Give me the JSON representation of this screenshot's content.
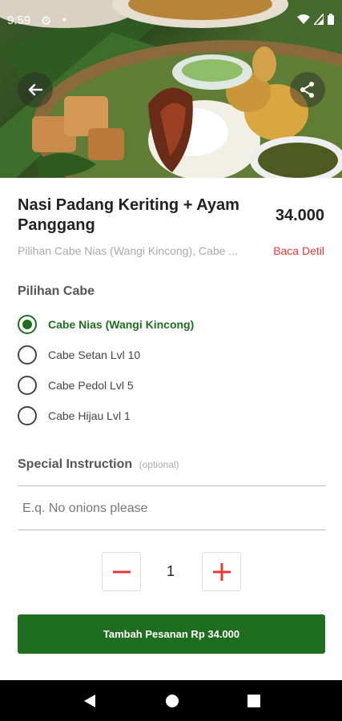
{
  "status_bar": {
    "time": "9:59",
    "icons": [
      "gear-icon",
      "dot-icon",
      "wifi-icon",
      "signal-icon",
      "battery-icon"
    ]
  },
  "hero": {
    "icons": {
      "back": "arrow-left-icon",
      "share": "share-icon"
    }
  },
  "product": {
    "title": "Nasi Padang Keriting + Ayam Panggang",
    "price": "34.000",
    "subtitle": "Pilihan Cabe Nias (Wangi Kincong), Cabe ...",
    "detail_link": "Baca Detil"
  },
  "options": {
    "title": "Pilihan Cabe",
    "items": [
      {
        "label": "Cabe Nias (Wangi Kincong)",
        "selected": true
      },
      {
        "label": "Cabe Setan Lvl 10",
        "selected": false
      },
      {
        "label": "Cabe Pedol Lvl 5",
        "selected": false
      },
      {
        "label": "Cabe Hijau Lvl 1",
        "selected": false
      }
    ]
  },
  "special": {
    "title": "Special Instruction",
    "optional_label": "(optional)",
    "placeholder": "E.q. No onions please",
    "value": ""
  },
  "quantity": {
    "value": "1"
  },
  "cta": {
    "label": "Tambah Pesanan Rp 34.000"
  },
  "colors": {
    "primary": "#1f6e1f",
    "link": "#e53935",
    "qty_icon": "#e53935"
  }
}
